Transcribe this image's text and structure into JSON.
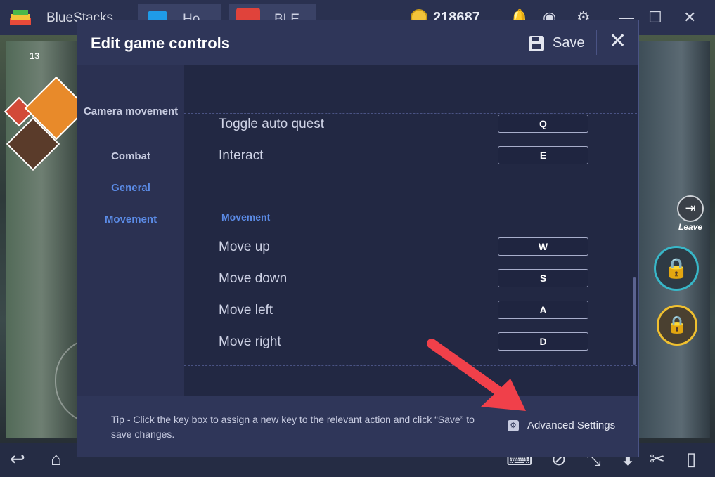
{
  "window": {
    "app_name": "BlueStacks",
    "tabs": [
      {
        "label": "Ho"
      },
      {
        "label": "BLE"
      }
    ],
    "coins": "218687"
  },
  "game": {
    "leave_label": "Leave",
    "level_badge": "13"
  },
  "dialog": {
    "title": "Edit game controls",
    "save_label": "Save",
    "close_glyph": "✕",
    "sidebar": [
      "Camera movement",
      "Combat",
      "General",
      "Movement"
    ],
    "active_sidebar": [
      "General",
      "Movement"
    ],
    "controls": [
      {
        "label": "Toggle auto quest",
        "key": "Q"
      },
      {
        "label": "Interact",
        "key": "E"
      }
    ],
    "movement_section": {
      "title": "Movement",
      "controls": [
        {
          "label": "Move up",
          "key": "W"
        },
        {
          "label": "Move down",
          "key": "S"
        },
        {
          "label": "Move left",
          "key": "A"
        },
        {
          "label": "Move right",
          "key": "D"
        }
      ]
    },
    "tip": "Tip - Click the key box to assign a new key to the relevant action and click “Save” to save changes.",
    "advanced_settings_label": "Advanced Settings"
  },
  "colors": {
    "accent": "#5b8be6",
    "dialog_bg": "#2b3152",
    "annotation_arrow": "#f0404a"
  },
  "icons": [
    "bluestacks-logo-icon",
    "coin-icon",
    "save-icon",
    "close-icon",
    "gear-icon",
    "lock-icon",
    "back-icon",
    "home-icon",
    "keyboard-icon",
    "scissors-icon",
    "phone-icon"
  ]
}
